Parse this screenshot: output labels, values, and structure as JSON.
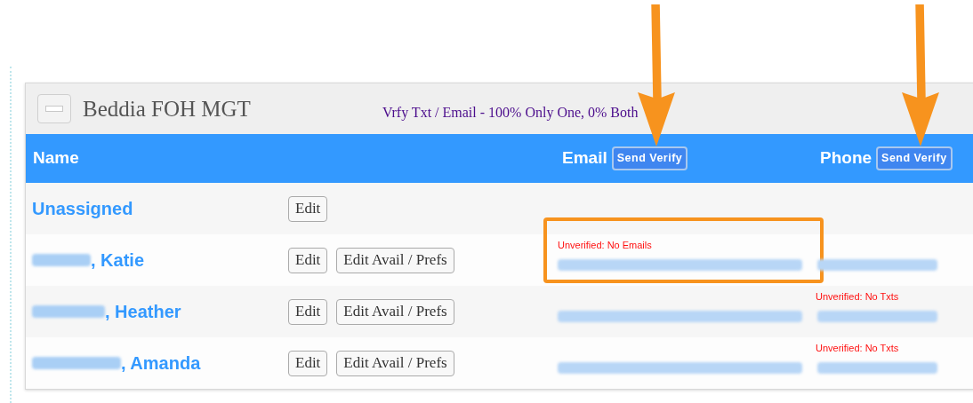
{
  "panel": {
    "title": "Beddia FOH MGT",
    "subtitle": "Vrfy Txt / Email - 100% Only One, 0% Both",
    "collapsed": false
  },
  "columns": [
    {
      "label": "Name"
    },
    {
      "label": "Email",
      "button": "Send Verify",
      "arrow": true
    },
    {
      "label": "Phone",
      "button": "Send Verify",
      "arrow": true
    }
  ],
  "rows": [
    {
      "name": "Unassigned",
      "name_redacted": false,
      "buttons": [
        "Edit"
      ]
    },
    {
      "name": ", Katie",
      "name_redacted": true,
      "buttons": [
        "Edit",
        "Edit Avail / Prefs"
      ],
      "email": {
        "warning": "Unverified: No Emails",
        "redacted": true,
        "highlighted": true
      },
      "phone": {
        "redacted": true,
        "highlighted": false
      }
    },
    {
      "name": ", Heather",
      "name_redacted": true,
      "buttons": [
        "Edit",
        "Edit Avail / Prefs"
      ],
      "email": {
        "redacted": true,
        "highlighted": false
      },
      "phone": {
        "warning": "Unverified: No Txts",
        "redacted": true,
        "highlighted": false
      }
    },
    {
      "name": ", Amanda",
      "name_redacted": true,
      "buttons": [
        "Edit",
        "Edit Avail / Prefs"
      ],
      "email": {
        "redacted": true,
        "highlighted": false
      },
      "phone": {
        "warning": "Unverified: No Txts",
        "redacted": true,
        "highlighted": false
      }
    }
  ]
}
